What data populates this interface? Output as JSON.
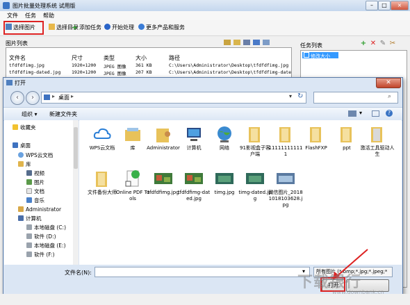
{
  "app": {
    "title": "图片批量处理系统 试用版",
    "menus": [
      "文件",
      "任务",
      "帮助"
    ],
    "toolbar": [
      "选择图片",
      "选择目录",
      "添加任务",
      "开始处理",
      "更多产品和服务"
    ]
  },
  "file_panel": {
    "title": "图片列表",
    "columns": [
      "文件名",
      "尺寸",
      "类型",
      "大小",
      "路径"
    ],
    "rows": [
      [
        "tfdfdfimg.jpg",
        "1920×1200",
        "JPEG 图像",
        "361 KB",
        "C:\\Users\\Administrator\\Desktop\\tfdfdfimg.jpg"
      ],
      [
        "tfdfdfimg-dated.jpg",
        "1920×1200",
        "JPEG 图像",
        "207 KB",
        "C:\\Users\\Administrator\\Desktop\\tfdfdfimg-dated.jpg"
      ]
    ]
  },
  "task_panel": {
    "title": "任务列表",
    "items": [
      "修改大小"
    ]
  },
  "dialog": {
    "title": "打开",
    "address": "桌面",
    "organize_label": "组织",
    "new_folder_label": "新建文件夹",
    "nav": {
      "favorites": "收藏夹",
      "desktop": "桌面",
      "wps": "WPS云文档",
      "library": "库",
      "video": "视频",
      "pictures": "图片",
      "documents": "文档",
      "music": "音乐",
      "admin": "Administrator",
      "computer": "计算机",
      "disk_c": "本地磁盘 (C:)",
      "disk_d": "软件 (D:)",
      "disk_e": "本地磁盘 (E:)",
      "disk_f": "软件 (F:)"
    },
    "files": [
      {
        "name": "WPS云文档",
        "icon": "cloud-icon"
      },
      {
        "name": "库",
        "icon": "library-folder-icon"
      },
      {
        "name": "Administrator",
        "icon": "user-folder-icon"
      },
      {
        "name": "计算机",
        "icon": "computer-icon"
      },
      {
        "name": "网络",
        "icon": "network-globe-icon"
      },
      {
        "name": "91影视盒子客户端",
        "icon": "folder-icon"
      },
      {
        "name": "111111111111",
        "icon": "folder-icon"
      },
      {
        "name": "FlashFXP",
        "icon": "folder-icon"
      },
      {
        "name": "ppt",
        "icon": "folder-icon"
      },
      {
        "name": "激活工具驱动人生",
        "icon": "folder-icon"
      },
      {
        "name": "文件备份大师",
        "icon": "folder-icon"
      },
      {
        "name": "Online PDF Tools",
        "icon": "pdf-shortcut-icon"
      },
      {
        "name": "tfdfdfimg.jpg",
        "icon": "image-thumbnail-icon"
      },
      {
        "name": "tfdfdfimg-dated.jpg",
        "icon": "image-thumbnail-icon"
      },
      {
        "name": "timg.jpg",
        "icon": "image-thumbnail-icon"
      },
      {
        "name": "timg-dated.jpg",
        "icon": "image-thumbnail-icon"
      },
      {
        "name": "微信图片_20181018103628.jpg",
        "icon": "image-thumbnail-icon"
      }
    ],
    "filename_label": "文件名(N):",
    "filename_value": "",
    "filter": "所有图片 (*.bmp;*.jpg;*.jpeg;*",
    "open_button": "打开"
  },
  "watermark": {
    "text": "下载银行",
    "sub": "www.downbank.cn"
  }
}
